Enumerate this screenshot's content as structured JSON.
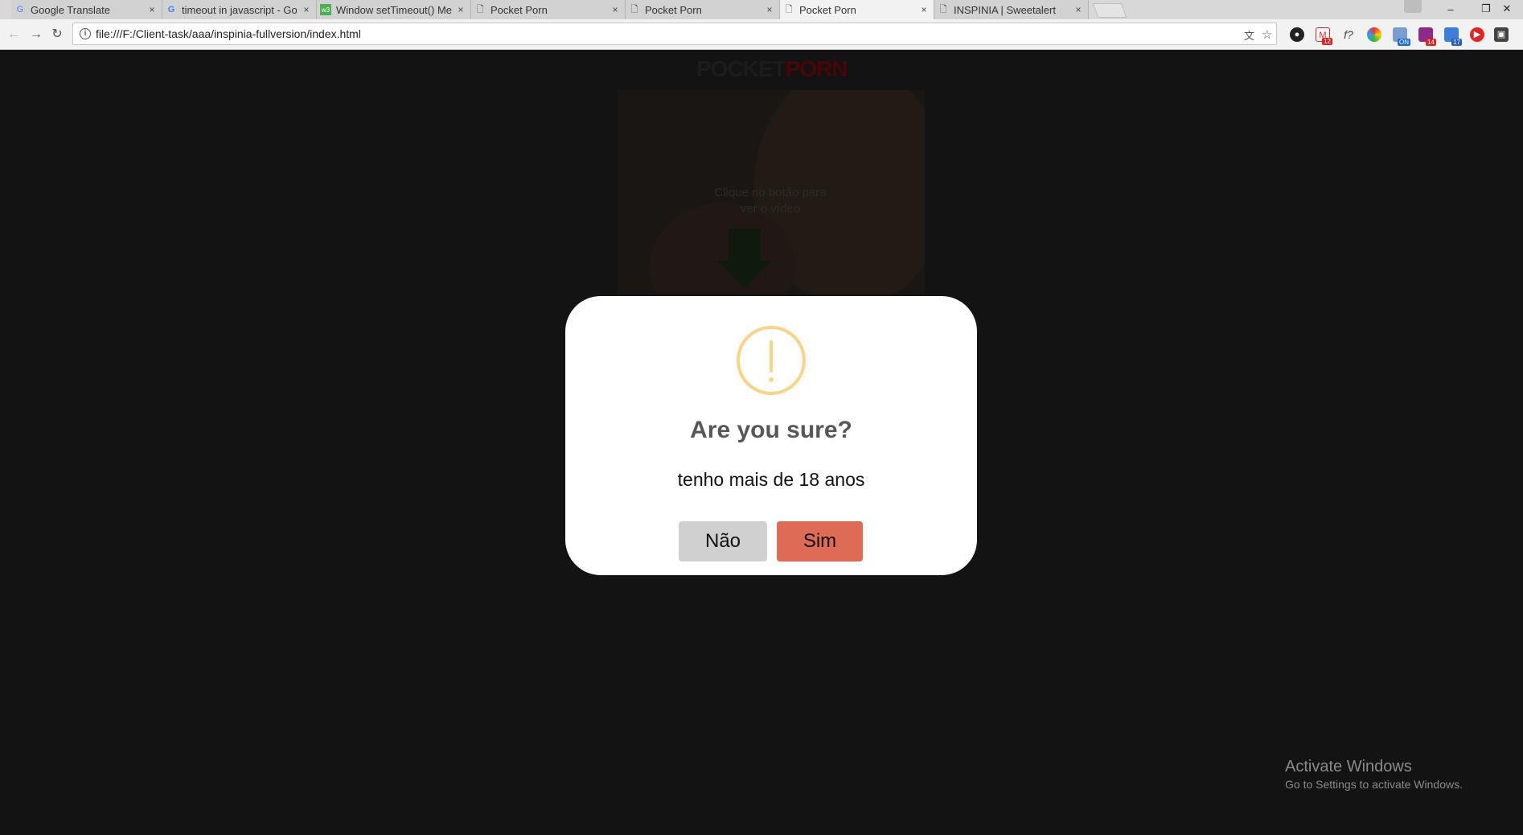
{
  "browser": {
    "tabs": [
      {
        "title": "Google Translate",
        "favicon": "google-translate-icon",
        "active": false
      },
      {
        "title": "timeout in javascript - Go",
        "favicon": "google-icon",
        "active": false
      },
      {
        "title": "Window setTimeout() Me",
        "favicon": "w3schools-icon",
        "active": false
      },
      {
        "title": "Pocket Porn",
        "favicon": "page-icon",
        "active": false
      },
      {
        "title": "Pocket Porn",
        "favicon": "page-icon",
        "active": false
      },
      {
        "title": "Pocket Porn",
        "favicon": "page-icon",
        "active": true
      },
      {
        "title": "INSPINIA | Sweetalert",
        "favicon": "page-icon",
        "active": false
      }
    ],
    "close_glyph": "×",
    "address_bar": {
      "url": "file:///F:/Client-task/aaa/inspinia-fullversion/index.html"
    },
    "window_controls": {
      "minimize": "–",
      "restore": "❐",
      "close": "✕"
    },
    "extension_badges": {
      "gmail": "12",
      "calendar": "ON",
      "ext_14": "14",
      "ext_17": "17"
    }
  },
  "page": {
    "brand": {
      "part1": "POCKET",
      "part2": "PORN"
    },
    "video": {
      "cta_line1": "Clique no botão para",
      "cta_line2": "ver o vídeo"
    }
  },
  "dialog": {
    "icon": "warning-icon",
    "title": "Are you sure?",
    "text": "tenho mais de 18 anos",
    "cancel_label": "Não",
    "confirm_label": "Sim",
    "colors": {
      "confirm": "#dd6b55",
      "cancel": "#d0d0d0",
      "icon": "#f8d486"
    }
  },
  "watermark": {
    "line1": "Activate Windows",
    "line2": "Go to Settings to activate Windows."
  }
}
